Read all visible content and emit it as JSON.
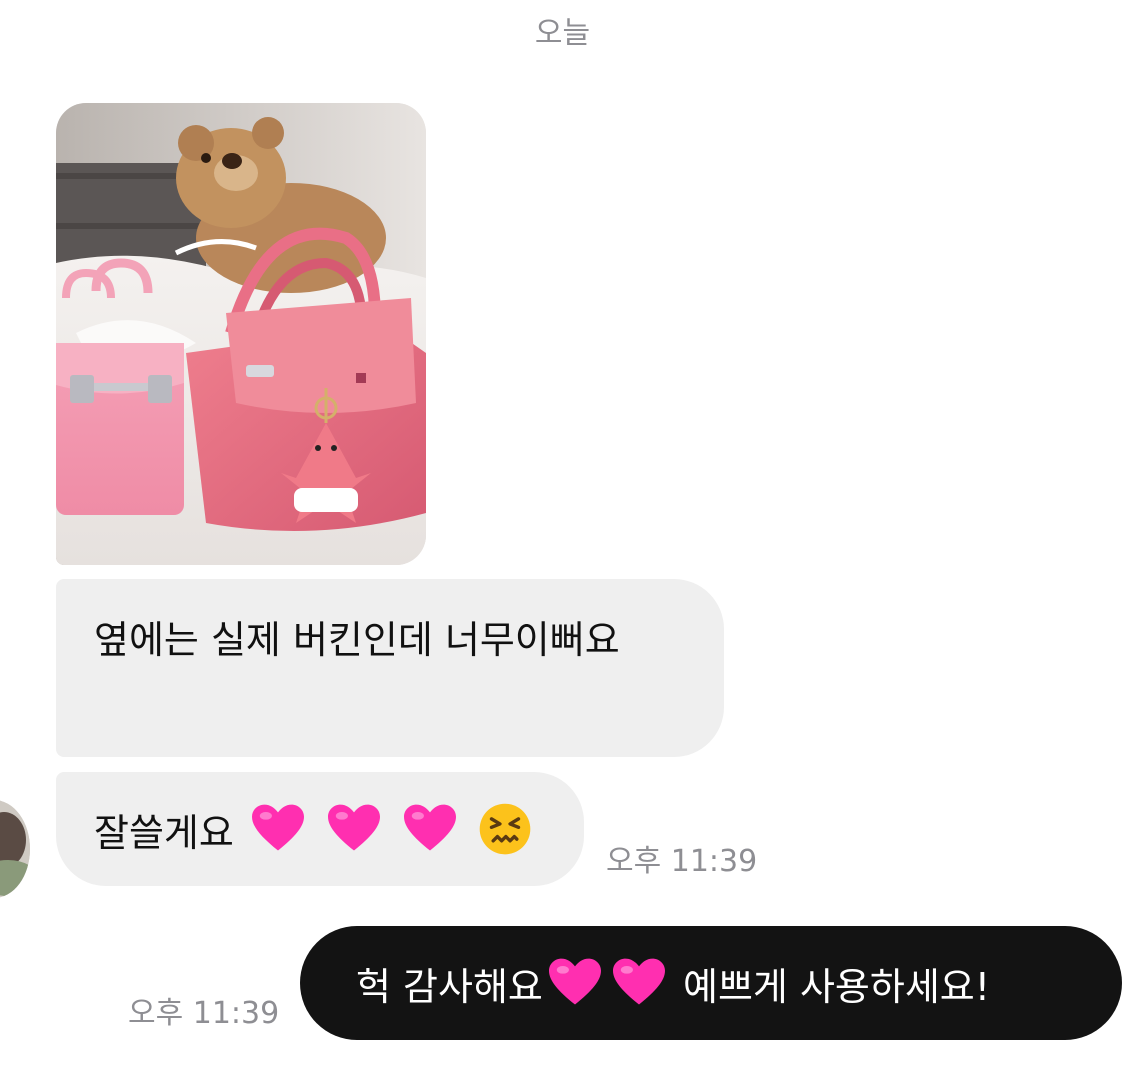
{
  "date_separator": "오늘",
  "messages": [
    {
      "sender": "other",
      "type": "photo",
      "icon": "photo-of-pink-bags-and-teddy-bear"
    },
    {
      "sender": "other",
      "type": "text",
      "text": "옆에는 실제 버킨인데 너무이뻐요"
    },
    {
      "sender": "other",
      "type": "text",
      "text": "잘쓸게요",
      "emoji": [
        "pink-heart-icon",
        "pink-heart-icon",
        "pink-heart-icon",
        "confounded-face-icon"
      ],
      "time": "오후 11:39"
    },
    {
      "sender": "me",
      "type": "text",
      "text_before": "헉 감사해요",
      "emoji": [
        "pink-heart-icon",
        "pink-heart-icon"
      ],
      "text_after": "예쁘게 사용하세요!",
      "time": "오후 11:39"
    }
  ],
  "colors": {
    "incoming_bubble": "#efefef",
    "outgoing_bubble": "#131313",
    "meta_text": "#8e8e93",
    "heart": "#ff2fb0"
  }
}
